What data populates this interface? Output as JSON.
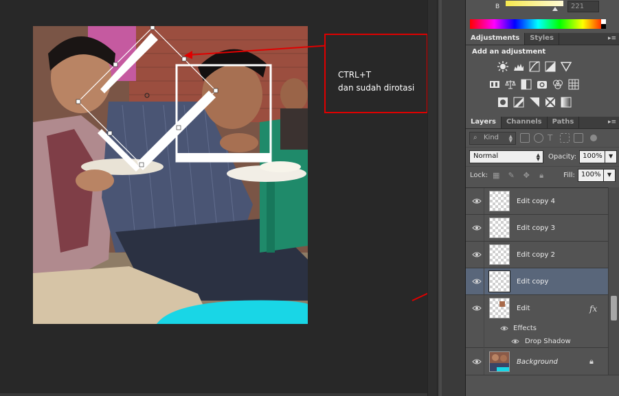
{
  "color_panel": {
    "channel_label": "B",
    "channel_value": "221"
  },
  "adjustments_panel": {
    "tabs": [
      {
        "label": "Adjustments",
        "active": true
      },
      {
        "label": "Styles",
        "active": false
      }
    ],
    "heading": "Add an adjustment",
    "icon_rows": [
      [
        "brightness-contrast-icon",
        "levels-icon",
        "curves-icon",
        "exposure-icon",
        "vibrance-icon"
      ],
      [
        "hue-saturation-icon",
        "color-balance-icon",
        "black-white-icon",
        "photo-filter-icon",
        "channel-mixer-icon",
        "color-lookup-icon"
      ],
      [
        "invert-icon",
        "posterize-icon",
        "threshold-icon",
        "selective-color-icon",
        "gradient-map-icon"
      ]
    ]
  },
  "layers_panel": {
    "tabs": [
      {
        "label": "Layers",
        "active": true
      },
      {
        "label": "Channels",
        "active": false
      },
      {
        "label": "Paths",
        "active": false
      }
    ],
    "kind_filter": "Kind",
    "blend_mode": "Normal",
    "opacity_label": "Opacity:",
    "opacity_value": "100%",
    "lock_label": "Lock:",
    "fill_label": "Fill:",
    "fill_value": "100%",
    "layers": [
      {
        "name": "Edit copy 4",
        "selected": false
      },
      {
        "name": "Edit copy 3",
        "selected": false
      },
      {
        "name": "Edit copy 2",
        "selected": false
      },
      {
        "name": "Edit copy",
        "selected": true
      },
      {
        "name": "Edit",
        "selected": false,
        "has_fx": true,
        "fx_label": "fx"
      }
    ],
    "effects_label": "Effects",
    "drop_shadow_label": "Drop Shadow",
    "background_layer": "Background"
  },
  "annotation": {
    "line1": "CTRL+T",
    "line2": "dan sudah dirotasi",
    "accent_color": "#e00000"
  }
}
